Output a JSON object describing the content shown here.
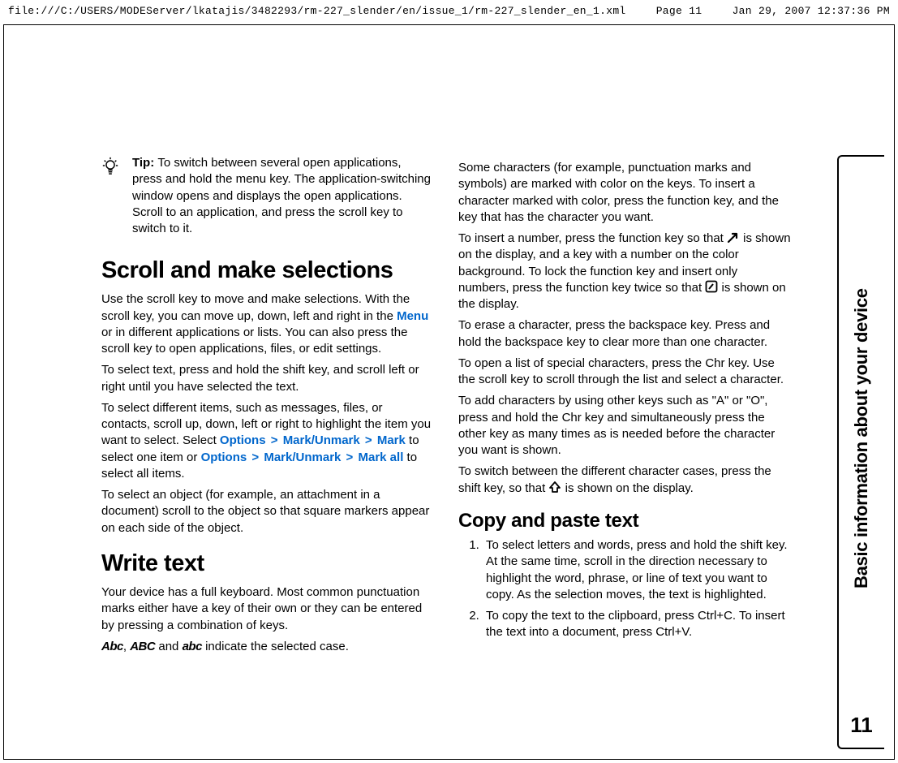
{
  "header": {
    "path": "file:///C:/USERS/MODEServer/lkatajis/3482293/rm-227_slender/en/issue_1/rm-227_slender_en_1.xml",
    "page": "Page 11",
    "timestamp": "Jan 29, 2007 12:37:36 PM"
  },
  "sidebar": {
    "title": "Basic information about your device",
    "page_number": "11"
  },
  "tip": {
    "label": "Tip: ",
    "body": "To switch between several open applications, press and hold the menu key. The application-switching window opens and displays the open applications. Scroll to an application, and press the scroll key to switch to it."
  },
  "sections": {
    "scroll": {
      "heading": "Scroll and make selections",
      "p1a": "Use the scroll key to move and make selections. With the scroll key, you can move up, down, left and right in the ",
      "menu": "Menu",
      "p1b": " or in different applications or lists. You can also press the scroll key to open applications, files, or edit settings.",
      "p2": "To select text, press and hold the shift key, and scroll left or right until you have selected the text.",
      "p3a": "To select different items, such as messages, files, or contacts, scroll up, down, left or right to highlight the item you want to select. Select ",
      "opt": "Options",
      "mu": "Mark/Unmark",
      "mark": "Mark",
      "p3b": " to select one item or ",
      "markall": "Mark all",
      "p3c": " to select all items.",
      "p4": "To select an object (for example, an attachment in a document) scroll to the object so that square markers appear on each side of the object."
    },
    "write": {
      "heading": "Write text",
      "p1": "Your device has a full keyboard. Most common punctuation marks either have a key of their own or they can be entered by pressing a combination of keys.",
      "ind1": "Abc",
      "ind2": "ABC",
      "ind3": "abc",
      "p2a": ", ",
      "p2b": " and ",
      "p2c": " indicate the selected case."
    },
    "col2": {
      "p1": "Some characters (for example, punctuation marks and symbols) are marked with color on the keys. To insert a character marked with color, press the function key, and the key that has the character you want.",
      "p2a": "To insert a number, press the function key so that ",
      "p2b": " is shown on the display, and a key with a number on the color background. To lock the function key and insert only numbers, press the function key twice so that ",
      "p2c": " is shown on the display.",
      "p3": "To erase a character, press the backspace key. Press and hold the backspace key to clear more than one character.",
      "p4": "To open a list of special characters, press the Chr key. Use the scroll key to scroll through the list and select a character.",
      "p5": "To add characters by using other keys such as \"A\" or \"O\", press and hold the Chr key and simultaneously press the other key as many times as is needed before the character you want is shown.",
      "p6a": "To switch between the different character cases, press the shift key, so that ",
      "p6b": " is shown on the display."
    },
    "copy": {
      "heading": "Copy and paste text",
      "li1": "To select letters and words, press and hold the shift key. At the same time, scroll in the direction necessary to highlight the word, phrase, or line of text you want to copy. As the selection moves, the text is highlighted.",
      "li2": "To copy the text to the clipboard, press Ctrl+C. To insert the text into a document, press Ctrl+V."
    }
  }
}
